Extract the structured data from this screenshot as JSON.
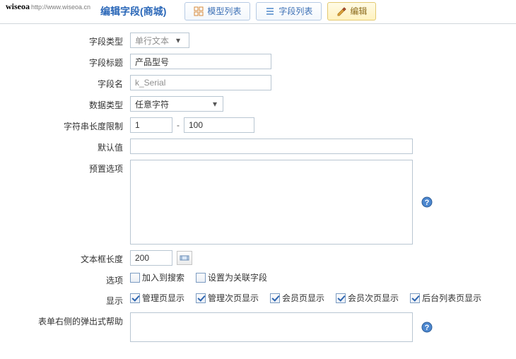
{
  "brand": {
    "name": "wiseoa",
    "url": "http://www.wiseoa.cn"
  },
  "page_title": "编辑字段(商城)",
  "tabs": {
    "model_list": "模型列表",
    "field_list": "字段列表",
    "edit": "编辑"
  },
  "labels": {
    "field_type": "字段类型",
    "field_title": "字段标题",
    "field_name": "字段名",
    "data_type": "数据类型",
    "str_len_limit": "字符串长度限制",
    "default_value": "默认值",
    "preset_options": "预置选项",
    "textbox_length": "文本框长度",
    "options": "选项",
    "display": "显示",
    "form_right_help": "表单右侧的弹出式帮助"
  },
  "values": {
    "field_type_selected": "单行文本",
    "field_title": "产品型号",
    "field_name": "k_Serial",
    "data_type_selected": "任意字符",
    "str_len_min": "1",
    "str_len_max": "100",
    "default_value": "",
    "preset_options": "",
    "textbox_length": "200",
    "form_right_help": ""
  },
  "options": {
    "add_to_search": {
      "label": "加入到搜索",
      "checked": false
    },
    "set_relation_field": {
      "label": "设置为关联字段",
      "checked": false
    }
  },
  "display_opts": {
    "admin_page": {
      "label": "管理页显示",
      "checked": true
    },
    "admin_sub_page": {
      "label": "管理次页显示",
      "checked": true
    },
    "member_page": {
      "label": "会员页显示",
      "checked": true
    },
    "member_sub_page": {
      "label": "会员次页显示",
      "checked": true
    },
    "backend_list": {
      "label": "后台列表页显示",
      "checked": true
    }
  },
  "separators": {
    "range_dash": "-"
  }
}
